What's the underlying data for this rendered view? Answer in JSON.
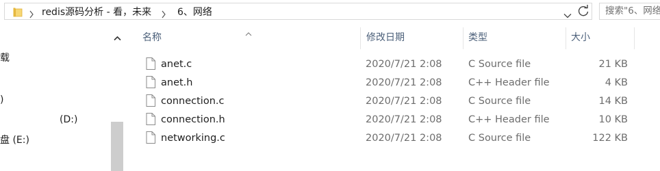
{
  "address_bar": {
    "breadcrumbs": [
      "redis源码分析 - 看，未来",
      "6、网络"
    ],
    "search_placeholder": "搜索\"6、网络\""
  },
  "nav_pane": {
    "items": [
      {
        "label": "载"
      },
      {
        "label": ")"
      },
      {
        "label": "(D:)"
      },
      {
        "label": "盘 (E:)"
      }
    ]
  },
  "file_list": {
    "columns": {
      "name": "名称",
      "date": "修改日期",
      "type": "类型",
      "size": "大小"
    },
    "rows": [
      {
        "name": "anet.c",
        "date": "2020/7/21 2:08",
        "type": "C Source file",
        "size": "21 KB"
      },
      {
        "name": "anet.h",
        "date": "2020/7/21 2:08",
        "type": "C++ Header file",
        "size": "4 KB"
      },
      {
        "name": "connection.c",
        "date": "2020/7/21 2:08",
        "type": "C Source file",
        "size": "14 KB"
      },
      {
        "name": "connection.h",
        "date": "2020/7/21 2:08",
        "type": "C++ Header file",
        "size": "10 KB"
      },
      {
        "name": "networking.c",
        "date": "2020/7/21 2:08",
        "type": "C Source file",
        "size": "122 KB"
      }
    ]
  },
  "colors": {
    "folder": "#e6b93e",
    "header_text": "#4c607a",
    "secondary_text": "#6d6d6d",
    "scroll_thumb": "#cdcdcd"
  }
}
